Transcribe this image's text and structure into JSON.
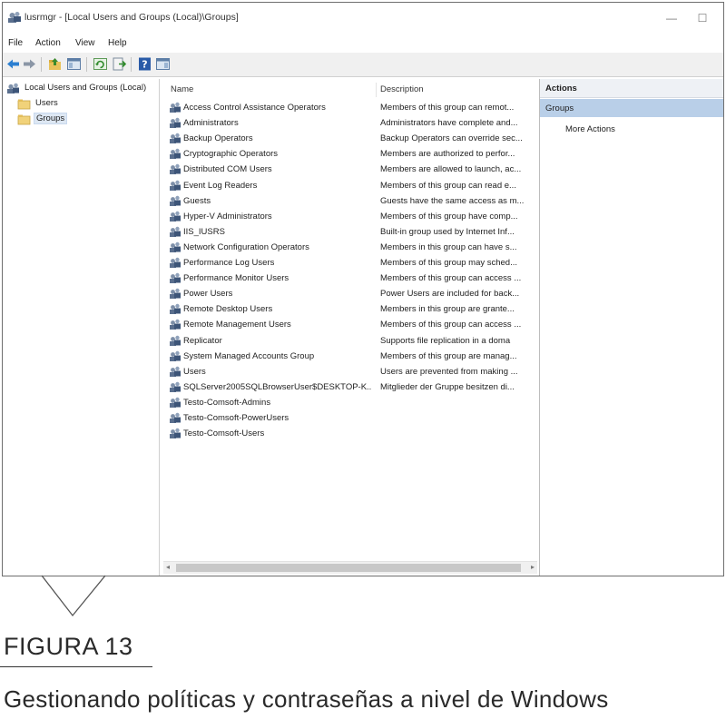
{
  "window": {
    "title": "lusrmgr - [Local Users and Groups (Local)\\Groups]",
    "minimize_glyph": "—",
    "maximize_glyph": "☐"
  },
  "menu": [
    "File",
    "Action",
    "View",
    "Help"
  ],
  "toolbar": {
    "icons": [
      "back-arrow-icon",
      "forward-arrow-icon",
      "up-folder-icon",
      "show-hide-console-tree-icon",
      "refresh-icon",
      "export-list-icon",
      "help-icon",
      "show-hide-action-pane-icon"
    ]
  },
  "tree": {
    "root": "Local Users and Groups (Local)",
    "children": [
      "Users",
      "Groups"
    ],
    "selected": "Groups"
  },
  "list": {
    "columns": [
      "Name",
      "Description"
    ],
    "rows": [
      {
        "name": "Access Control Assistance Operators",
        "desc": "Members of this group can remot..."
      },
      {
        "name": "Administrators",
        "desc": "Administrators have complete and..."
      },
      {
        "name": "Backup Operators",
        "desc": "Backup Operators can override sec..."
      },
      {
        "name": "Cryptographic Operators",
        "desc": "Members are authorized to perfor..."
      },
      {
        "name": "Distributed COM Users",
        "desc": "Members are allowed to launch, ac..."
      },
      {
        "name": "Event Log Readers",
        "desc": "Members of this group can read e..."
      },
      {
        "name": "Guests",
        "desc": "Guests have the same access as m..."
      },
      {
        "name": "Hyper-V Administrators",
        "desc": "Members of this group have comp..."
      },
      {
        "name": "IIS_IUSRS",
        "desc": "Built-in group used by Internet Inf..."
      },
      {
        "name": "Network Configuration Operators",
        "desc": "Members in this group can have s..."
      },
      {
        "name": "Performance Log Users",
        "desc": "Members of this group may sched..."
      },
      {
        "name": "Performance Monitor Users",
        "desc": "Members of this group can access ..."
      },
      {
        "name": "Power Users",
        "desc": "Power Users are included for back..."
      },
      {
        "name": "Remote Desktop Users",
        "desc": "Members in this group are grante..."
      },
      {
        "name": "Remote Management Users",
        "desc": "Members of this group can access ..."
      },
      {
        "name": "Replicator",
        "desc": "Supports file replication in a doma"
      },
      {
        "name": "System Managed Accounts Group",
        "desc": "Members of this group are manag..."
      },
      {
        "name": "Users",
        "desc": "Users are prevented from making ..."
      },
      {
        "name": "SQLServer2005SQLBrowserUser$DESKTOP-K...",
        "desc": "Mitglieder der Gruppe besitzen di..."
      },
      {
        "name": "Testo-Comsoft-Admins",
        "desc": ""
      },
      {
        "name": "Testo-Comsoft-PowerUsers",
        "desc": ""
      },
      {
        "name": "Testo-Comsoft-Users",
        "desc": ""
      }
    ]
  },
  "actions": {
    "header": "Actions",
    "section": "Groups",
    "items": [
      "More Actions"
    ]
  },
  "caption": {
    "label": "FIGURA 13",
    "text": "Gestionando políticas y contraseñas a nivel de Windows"
  },
  "colors": {
    "selection_tree": "#dde7f3",
    "actions_section": "#b9cfe8",
    "toolbar_bg": "#f0f0f0"
  }
}
